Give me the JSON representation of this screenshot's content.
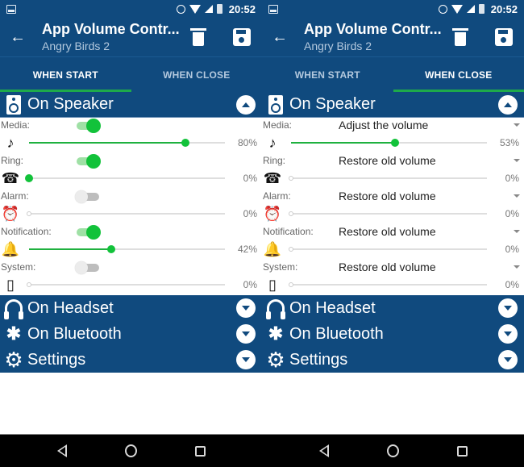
{
  "status_bar": {
    "time": "20:52"
  },
  "app_bar": {
    "title": "App Volume Contr...",
    "subtitle": "Angry Birds 2"
  },
  "tabs": [
    {
      "label": "WHEN START"
    },
    {
      "label": "WHEN CLOSE"
    }
  ],
  "colors": {
    "primary": "#104a7e",
    "accent": "#12c23a",
    "tab_indicator": "#1eaa4a"
  },
  "sections": {
    "speaker": "On Speaker",
    "headset": "On Headset",
    "bluetooth": "On Bluetooth",
    "settings": "Settings"
  },
  "left_screen": {
    "active_tab": "WHEN START",
    "streams": [
      {
        "label": "Media:",
        "enabled": true,
        "icon": "music-note-icon",
        "value": 80,
        "pct": "80%"
      },
      {
        "label": "Ring:",
        "enabled": true,
        "icon": "ring-icon",
        "value": 0,
        "pct": "0%"
      },
      {
        "label": "Alarm:",
        "enabled": false,
        "icon": "alarm-icon",
        "value": 0,
        "pct": "0%"
      },
      {
        "label": "Notification:",
        "enabled": true,
        "icon": "bell-icon",
        "value": 42,
        "pct": "42%"
      },
      {
        "label": "System:",
        "enabled": false,
        "icon": "phone-icon",
        "value": 0,
        "pct": "0%"
      }
    ]
  },
  "right_screen": {
    "active_tab": "WHEN CLOSE",
    "streams": [
      {
        "label": "Media:",
        "mode": "Adjust the volume",
        "icon": "music-note-icon",
        "value": 53,
        "pct": "53%"
      },
      {
        "label": "Ring:",
        "mode": "Restore old volume",
        "icon": "ring-icon",
        "value": 0,
        "pct": "0%"
      },
      {
        "label": "Alarm:",
        "mode": "Restore old volume",
        "icon": "alarm-icon",
        "value": 0,
        "pct": "0%"
      },
      {
        "label": "Notification:",
        "mode": "Restore old volume",
        "icon": "bell-icon",
        "value": 0,
        "pct": "0%"
      },
      {
        "label": "System:",
        "mode": "Restore old volume",
        "icon": "phone-icon",
        "value": 0,
        "pct": "0%"
      }
    ]
  }
}
